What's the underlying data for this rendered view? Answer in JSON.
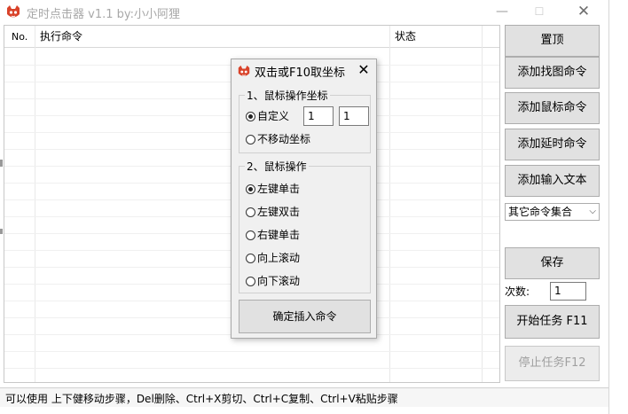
{
  "window": {
    "title": "定时点击器 v1.1 by:小小阿狸",
    "min_glyph": "—",
    "max_glyph": "☐",
    "close_glyph": "✕"
  },
  "list": {
    "columns": [
      "No.",
      "执行命令",
      "状态"
    ]
  },
  "buttons": {
    "top": "置顶",
    "add_image": "添加找图命令",
    "add_mouse": "添加鼠标命令",
    "add_delay": "添加延时命令",
    "add_text": "添加输入文本",
    "save": "保存",
    "start": "开始任务 F11",
    "stop": "停止任务F12"
  },
  "combo": {
    "selected": "其它命令集合",
    "arrow": "⌵"
  },
  "count": {
    "label": "次数:",
    "value": "1"
  },
  "status": {
    "text": "可以使用 上下健移动步骤，Del删除、Ctrl+X剪切、Ctrl+C复制、Ctrl+V粘贴步骤"
  },
  "dialog": {
    "title": "双击或F10取坐标",
    "close_glyph": "✕",
    "group1_title": "1、鼠标操作坐标",
    "custom_label": "自定义",
    "x_value": "1",
    "y_value": "1",
    "nomove_label": "不移动坐标",
    "group2_title": "2、鼠标操作",
    "ops": [
      "左键单击",
      "左键双击",
      "右键单击",
      "向上滚动",
      "向下滚动"
    ],
    "insert_label": "确定插入命令"
  },
  "colors": {
    "button_face": "#e1e1e1",
    "disabled_text": "#a0a0a0",
    "icon_red": "#d9432a"
  },
  "icons": {
    "app": "cat-face-icon",
    "dialog": "cat-face-icon"
  }
}
